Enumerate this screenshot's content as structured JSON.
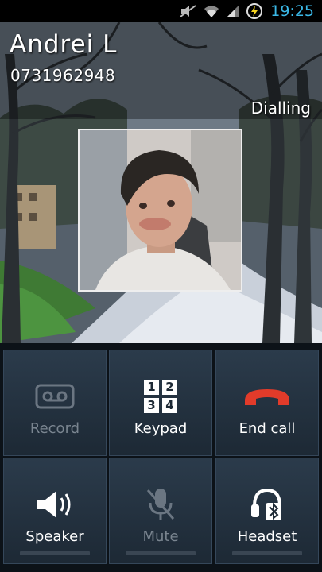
{
  "status_bar": {
    "time": "19:25"
  },
  "caller": {
    "name": "Andrei L",
    "number": "0731962948",
    "status": "Dialling"
  },
  "buttons": {
    "record": "Record",
    "keypad": "Keypad",
    "end_call": "End call",
    "speaker": "Speaker",
    "mute": "Mute",
    "headset": "Headset"
  },
  "keypad_icon_digits": [
    "1",
    "2",
    "3",
    "4"
  ],
  "colors": {
    "accent_clock": "#3bb9e8",
    "end_call_red": "#e23b2a",
    "button_bg": "#24323f"
  }
}
